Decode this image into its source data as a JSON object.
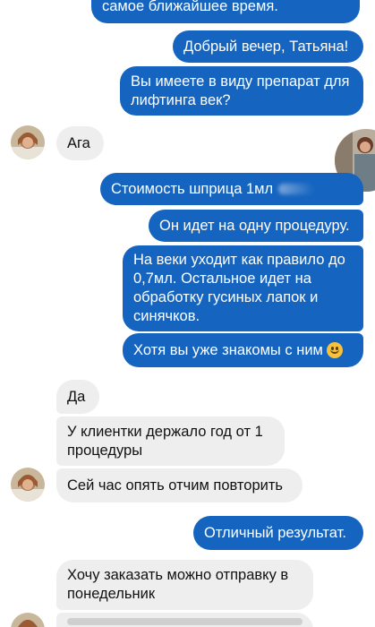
{
  "messages": {
    "m1": "самое ближайшее время.",
    "m2": "Добрый вечер, Татьяна!",
    "m3": "Вы имеете в виду препарат для\nлифтинга век?",
    "m4": "Ага",
    "m5": "Стоимость шприца 1мл",
    "m6": "Он идет на одну процедуру.",
    "m7": "На веки уходит как правило до\n0,7мл. Остальное идет на\nобработку гусиных лапок и\nсинячков.",
    "m8": "Хотя вы уже знакомы с ним",
    "m9": "Да",
    "m10": "У клиентки держало год от 1\nпроцедуры",
    "m11": "Сей час опять отчим повторить",
    "m12": "Отличный результат.",
    "m13": "Хочу заказать можно отправку в\nпонедельник"
  },
  "icons": {
    "emoji": "smiling-face-emoji",
    "contact_avatar": "contact-avatar",
    "seller_avatar": "seller-avatar"
  },
  "colors": {
    "outgoing_bubble": "#1565c0",
    "incoming_bubble": "#eeeeee"
  }
}
